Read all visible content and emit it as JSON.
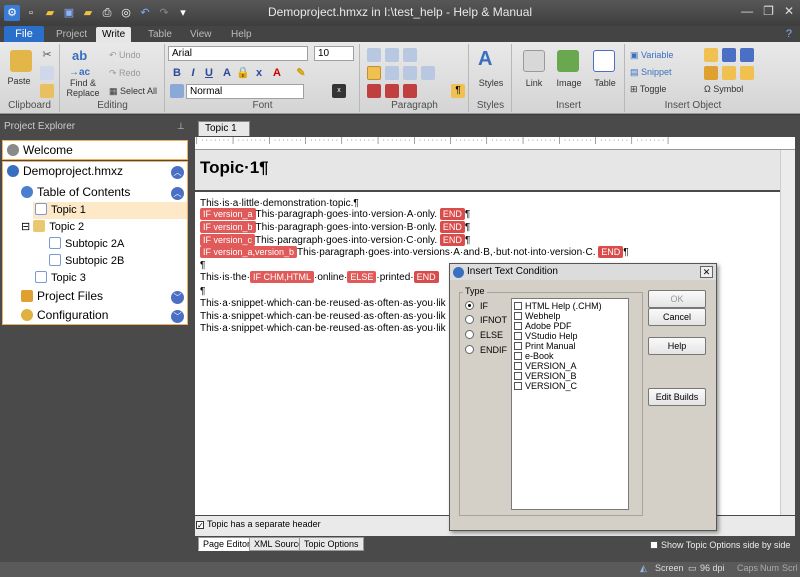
{
  "window": {
    "title": "Demoproject.hmxz in I:\\test_help - Help & Manual"
  },
  "ribbon": {
    "tabs": [
      "File",
      "Project",
      "Write",
      "Table",
      "View",
      "Help"
    ],
    "clipboard": {
      "paste": "Paste",
      "group": "Clipboard"
    },
    "editing": {
      "find_replace_1": "Find &",
      "find_replace_2": "Replace",
      "undo": "Undo",
      "redo": "Redo",
      "select_all": "Select All",
      "group": "Editing"
    },
    "font": {
      "name": "Arial",
      "size": "10",
      "style": "Normal",
      "group": "Font"
    },
    "paragraph": {
      "group": "Paragraph"
    },
    "styles": {
      "label": "Styles",
      "group": "Styles"
    },
    "insert": {
      "link": "Link",
      "image": "Image",
      "table": "Table",
      "group": "Insert"
    },
    "insert_object": {
      "variable": "Variable",
      "snippet": "Snippet",
      "toggle": "Toggle",
      "symbol": "Symbol",
      "group": "Insert Object"
    }
  },
  "sidebar": {
    "header": "Project Explorer",
    "welcome": "Welcome",
    "project": "Demoproject.hmxz",
    "toc": "Table of Contents",
    "items": [
      "Topic 1",
      "Topic 2",
      "Subtopic 2A",
      "Subtopic 2B",
      "Topic 3"
    ],
    "project_files": "Project Files",
    "configuration": "Configuration"
  },
  "editor": {
    "tab": "Topic 1",
    "topic_title": "Topic·1¶",
    "lines": {
      "l1": "This·is·a·little·demonstration·topic.¶",
      "if_a": "IF version_a",
      "t_a": "This·paragraph·goes·into·version·A·only.",
      "if_b": "IF version_b",
      "t_b": "This·paragraph·goes·into·version·B·only.",
      "if_c": "IF version_c",
      "t_c": "This·paragraph·goes·into·version·C·only.",
      "if_ab": "IF version_a,version_b",
      "t_ab": "This·paragraph·goes·into·versions·A·and·B,·but·not·into·version·C.",
      "end": "END",
      "pilcrow": "¶",
      "t_the": "This·is·the·",
      "if_chm": "IF CHM,HTML",
      "t_online": "·online·",
      "else": "ELSE",
      "t_printed": "·printed·",
      "snippet": "This·a·snippet·which·can·be·reused·as·often·as·you·lik"
    },
    "separate_header": "Topic has a separate header",
    "bottom_tabs": [
      "Page Editor",
      "XML Source",
      "Topic Options"
    ],
    "show_options": "Show Topic Options side by side"
  },
  "dialog": {
    "title": "Insert Text Condition",
    "type_label": "Type",
    "types": [
      "IF",
      "IFNOT",
      "ELSE",
      "ENDIF"
    ],
    "conditions": [
      "HTML Help (.CHM)",
      "Webhelp",
      "Adobe PDF",
      "VStudio Help",
      "Print Manual",
      "e-Book",
      "VERSION_A",
      "VERSION_B",
      "VERSION_C"
    ],
    "ok": "OK",
    "cancel": "Cancel",
    "help": "Help",
    "edit_builds": "Edit Builds"
  },
  "status": {
    "screen": "Screen",
    "dpi": "96 dpi",
    "caps": "Caps",
    "num": "Num",
    "scrl": "Scrl"
  }
}
